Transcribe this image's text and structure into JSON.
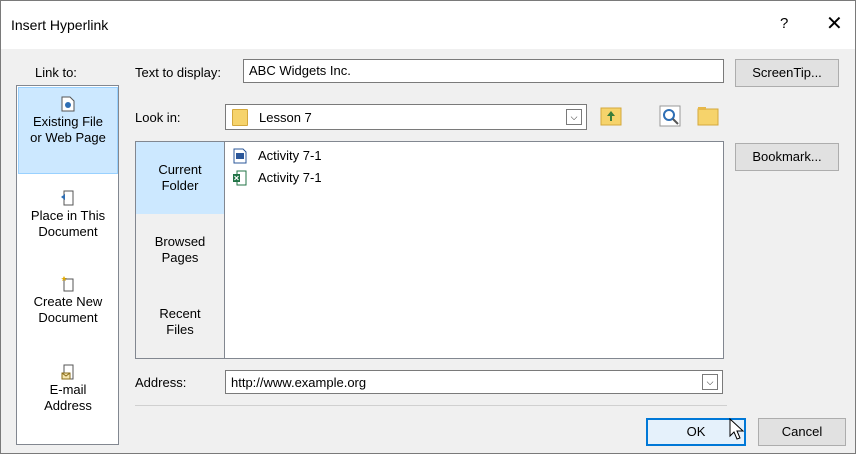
{
  "dialog": {
    "title": "Insert Hyperlink",
    "help_label": "?",
    "close_label": "✕"
  },
  "link_to": {
    "label": "Link to:",
    "items": [
      {
        "line1": "Existing File",
        "line2": "or Web Page",
        "selected": true,
        "icon": "existing-file-icon"
      },
      {
        "line1": "Place in This",
        "line2": "Document",
        "selected": false,
        "icon": "place-in-document-icon"
      },
      {
        "line1": "Create New",
        "line2": "Document",
        "selected": false,
        "icon": "create-new-document-icon"
      },
      {
        "line1": "E-mail",
        "line2": "Address",
        "selected": false,
        "icon": "email-address-icon"
      }
    ]
  },
  "text_to_display": {
    "label": "Text to display:",
    "value": "ABC Widgets Inc."
  },
  "screentip_button": "ScreenTip...",
  "look_in": {
    "label": "Look in:",
    "value": "Lesson 7"
  },
  "browse_tabs": [
    {
      "line1": "Current",
      "line2": "Folder",
      "selected": true
    },
    {
      "line1": "Browsed",
      "line2": "Pages",
      "selected": false
    },
    {
      "line1": "Recent",
      "line2": "Files",
      "selected": false
    }
  ],
  "files": [
    {
      "name": "Activity 7-1",
      "type": "word"
    },
    {
      "name": "Activity 7-1",
      "type": "excel"
    }
  ],
  "bookmark_button": "Bookmark...",
  "address": {
    "label": "Address:",
    "value": "http://www.example.org"
  },
  "ok_button": "OK",
  "cancel_button": "Cancel",
  "colors": {
    "selection": "#cce8ff",
    "accent": "#0078d7",
    "folder": "#f6d36b"
  }
}
